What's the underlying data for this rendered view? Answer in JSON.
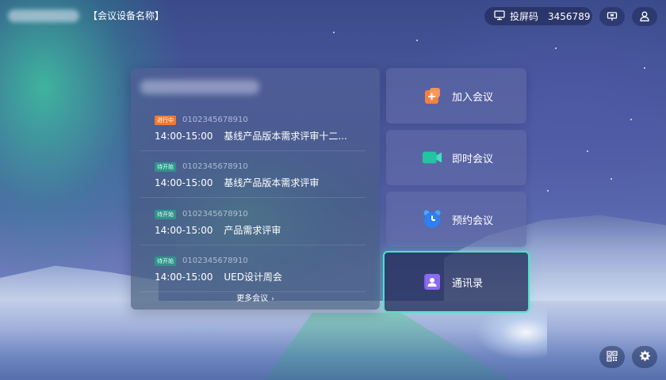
{
  "device_name": "【会议设备名称】",
  "cast": {
    "label": "投屏码",
    "code": "3456789"
  },
  "meetings": [
    {
      "status": "进行中",
      "status_type": "ongoing",
      "id": "0102345678910",
      "time": "14:00-15:00",
      "title": "基线产品版本需求评审十二..."
    },
    {
      "status": "待开始",
      "status_type": "pending",
      "id": "0102345678910",
      "time": "14:00-15:00",
      "title": "基线产品版本需求评审"
    },
    {
      "status": "待开始",
      "status_type": "pending",
      "id": "0102345678910",
      "time": "14:00-15:00",
      "title": "产品需求评审"
    },
    {
      "status": "待开始",
      "status_type": "pending",
      "id": "0102345678910",
      "time": "14:00-15:00",
      "title": "UED设计周会"
    }
  ],
  "more_label": "更多会议",
  "tiles": [
    {
      "label": "加入会议",
      "icon": "join-meeting-icon",
      "color": "#f5803b"
    },
    {
      "label": "即时会议",
      "icon": "video-camera-icon",
      "color": "#22c4a4"
    },
    {
      "label": "预约会议",
      "icon": "alarm-clock-icon",
      "color": "#2f7ff0"
    },
    {
      "label": "通讯录",
      "icon": "contacts-icon",
      "color": "#7e5ce8",
      "selected": true
    }
  ],
  "colors": {
    "accent": "#4fe0c8",
    "ongoing": "#f07a32",
    "pending": "#28a08c"
  },
  "icons": {
    "monitor": "monitor-icon",
    "screen": "screen-share-icon",
    "user": "user-icon",
    "qr": "qr-code-icon",
    "settings": "gear-icon"
  }
}
